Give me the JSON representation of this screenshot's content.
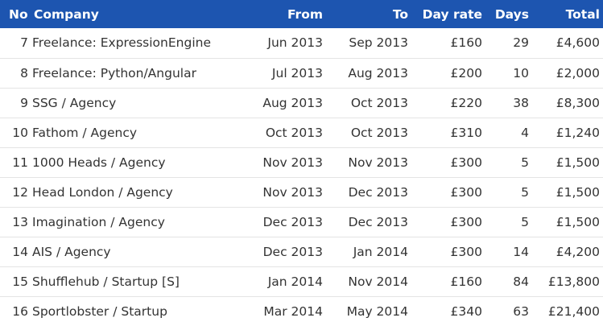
{
  "table": {
    "headers": {
      "no": "No",
      "company": "Company",
      "from": "From",
      "to": "To",
      "day_rate": "Day rate",
      "days": "Days",
      "total": "Total"
    },
    "header_bg": "#1d55b0",
    "rows": [
      {
        "no": "7",
        "company": "Freelance: ExpressionEngine",
        "from": "Jun 2013",
        "to": "Sep 2013",
        "day_rate": "£160",
        "days": "29",
        "total": "£4,600"
      },
      {
        "no": "8",
        "company": "Freelance: Python/Angular",
        "from": "Jul 2013",
        "to": "Aug 2013",
        "day_rate": "£200",
        "days": "10",
        "total": "£2,000"
      },
      {
        "no": "9",
        "company": "SSG / Agency",
        "from": "Aug 2013",
        "to": "Oct 2013",
        "day_rate": "£220",
        "days": "38",
        "total": "£8,300"
      },
      {
        "no": "10",
        "company": "Fathom / Agency",
        "from": "Oct 2013",
        "to": "Oct 2013",
        "day_rate": "£310",
        "days": "4",
        "total": "£1,240"
      },
      {
        "no": "11",
        "company": "1000 Heads / Agency",
        "from": "Nov 2013",
        "to": "Nov 2013",
        "day_rate": "£300",
        "days": "5",
        "total": "£1,500"
      },
      {
        "no": "12",
        "company": "Head London / Agency",
        "from": "Nov 2013",
        "to": "Dec 2013",
        "day_rate": "£300",
        "days": "5",
        "total": "£1,500"
      },
      {
        "no": "13",
        "company": "Imagination / Agency",
        "from": "Dec 2013",
        "to": "Dec 2013",
        "day_rate": "£300",
        "days": "5",
        "total": "£1,500"
      },
      {
        "no": "14",
        "company": "AIS / Agency",
        "from": "Dec 2013",
        "to": "Jan 2014",
        "day_rate": "£300",
        "days": "14",
        "total": "£4,200"
      },
      {
        "no": "15",
        "company": "Shufflehub / Startup [S]",
        "from": "Jan 2014",
        "to": "Nov 2014",
        "day_rate": "£160",
        "days": "84",
        "total": "£13,800"
      },
      {
        "no": "16",
        "company": "Sportlobster / Startup",
        "from": "Mar 2014",
        "to": "May 2014",
        "day_rate": "£340",
        "days": "63",
        "total": "£21,400"
      }
    ]
  }
}
